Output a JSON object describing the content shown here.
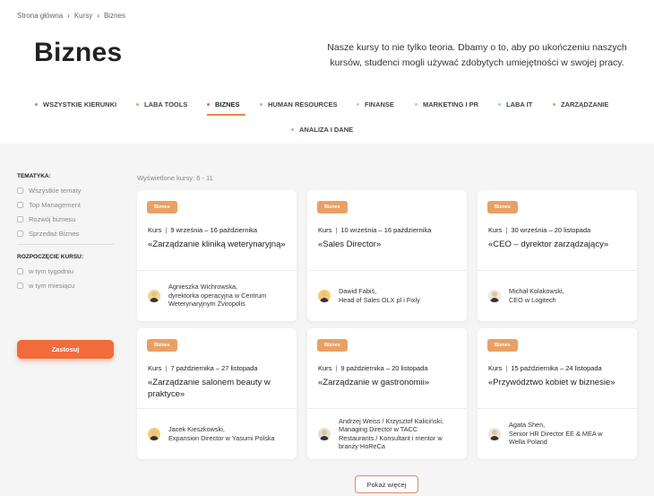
{
  "breadcrumb": [
    "Strona główna",
    "Kursy",
    "Biznes"
  ],
  "breadcrumb_sep": "›",
  "page_title": "Biznes",
  "intro": "Nasze kursy to nie tylko teoria. Dbamy o to, aby po ukończeniu naszych kursów, studenci mogli używać zdobytych umiejętności w swojej pracy.",
  "tabs": [
    {
      "label": "WSZYSTKIE KIERUNKI",
      "dot": "#999999"
    },
    {
      "label": "LABA TOOLS",
      "dot": "#e9a064"
    },
    {
      "label": "BIZNES",
      "dot": "#e8604a",
      "active": true
    },
    {
      "label": "HUMAN RESOURCES",
      "dot": "#aab4c8"
    },
    {
      "label": "FINANSE",
      "dot": "#c9c9c9"
    },
    {
      "label": "MARKETING I PR",
      "dot": "#c9c9c9"
    },
    {
      "label": "LABA IT",
      "dot": "#9fd0c4"
    },
    {
      "label": "ZARZĄDZANIE",
      "dot": "#e9a064"
    },
    {
      "label": "ANALIZA I DANE",
      "dot": "#e8a0a0"
    }
  ],
  "filters": {
    "topics_heading": "TEMATYKA:",
    "topics": [
      "Wszystkie tematy",
      "Top Management",
      "Rozwój biznesu",
      "Sprzedaż Biznes"
    ],
    "start_heading": "ROZPOCZĘCIE KURSU:",
    "start": [
      "w tym tygodniu",
      "w tym miesiącu"
    ],
    "apply_label": "Zastosuj"
  },
  "count_label": "Wyświetlone kursy: 6 - 11",
  "cards": [
    {
      "badge": "Biznes",
      "type": "Kurs",
      "dates": "9 września – 16 października",
      "title": "«Zarządzanie kliniką weterynaryjną»",
      "instructor": "Agnieszka Wichrowska,\ndyrektorka operacyjna w Centrum\nWeterynaryjnym Zviropolis"
    },
    {
      "badge": "Biznes",
      "type": "Kurs",
      "dates": "10 września – 16 października",
      "title": "«Sales Director»",
      "instructor": "Dawid Fabiś,\nHead of Sales OLX pl i Fixly"
    },
    {
      "badge": "Biznes",
      "type": "Kurs",
      "dates": "30 września – 20 listopada",
      "title": "«CEO – dyrektor zarządzający»",
      "instructor": "Michał Kolakowski,\nCEO w Logitech"
    },
    {
      "badge": "Biznes",
      "type": "Kurs",
      "dates": "7 października – 27 listopada",
      "title": "«Zarządzanie salonem beauty w praktyce»",
      "instructor": "Jacek Kieszkowski,\nExpansion Director w Yasumi Polska"
    },
    {
      "badge": "Biznes",
      "type": "Kurs",
      "dates": "9 października – 20 listopada",
      "title": "«Zarządzanie w gastronomii»",
      "instructor": "Andrzej Weiss / Krzysztof Kaliciński,\nManaging Director w TACC\nRestaurants / Konsultant i mentor w\nbranży HoReCa"
    },
    {
      "badge": "Biznes",
      "type": "Kurs",
      "dates": "15 października – 24 listopada",
      "title": "«Przywództwo kobiet w biznesie»",
      "instructor": "Agata Shen,\nSenior HR Director EE & MEA w\nWella Poland"
    }
  ],
  "more_label": "Pokaż więcej",
  "colors": {
    "accent": "#f26b3a",
    "badge": "#e9a064",
    "tab_underline": "#e8864a"
  }
}
